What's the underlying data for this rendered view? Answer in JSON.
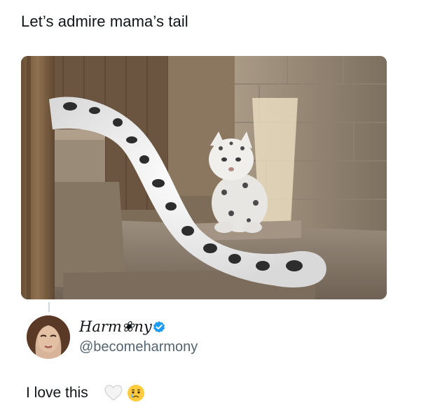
{
  "post": {
    "text": "Let’s admire mama’s tail",
    "image_subject": "snow leopard cub beside mother's long spotted tail on wooden steps"
  },
  "reply": {
    "display_name": "Harm❀ny",
    "handle": "@becomeharmony",
    "verified": true,
    "text": "I love this",
    "emojis": [
      "white-heart-icon",
      "crying-face-icon"
    ]
  },
  "colors": {
    "text": "#0f1419",
    "secondary_text": "#536471",
    "verified_blue": "#1d9bf0",
    "thread_line": "#cfd9de"
  }
}
